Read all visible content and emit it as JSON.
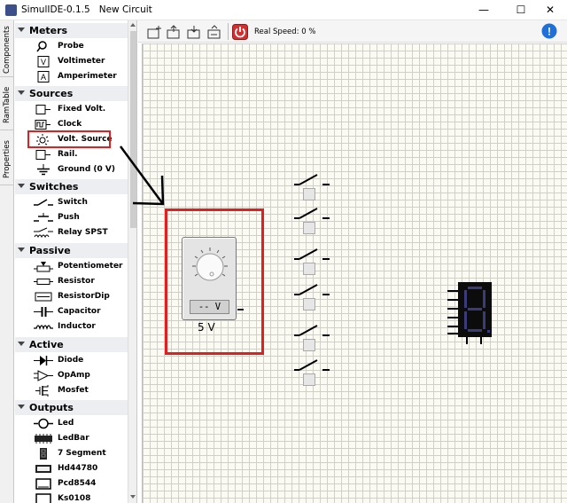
{
  "window": {
    "title": "SimulIDE-0.1.5   New Circuit",
    "controls": {
      "minimize": "—",
      "maximize": "☐",
      "close": "✕"
    }
  },
  "side_tabs": [
    "Components",
    "RamTable",
    "Properties"
  ],
  "categories": [
    {
      "label": "Meters",
      "items": [
        "Probe",
        "Voltimeter",
        "Amperimeter"
      ]
    },
    {
      "label": "Sources",
      "items": [
        "Fixed Volt.",
        "Clock",
        "Volt. Source",
        "Rail.",
        "Ground (0 V)"
      ]
    },
    {
      "label": "Switches",
      "items": [
        "Switch",
        "Push",
        "Relay SPST"
      ]
    },
    {
      "label": "Passive",
      "items": [
        "Potentiometer",
        "Resistor",
        "ResistorDip",
        "Capacitor",
        "Inductor"
      ]
    },
    {
      "label": "Active",
      "items": [
        "Diode",
        "OpAmp",
        "Mosfet"
      ]
    },
    {
      "label": "Outputs",
      "items": [
        "Led",
        "LedBar",
        "7 Segment",
        "Hd44780",
        "Pcd8544",
        "Ks0108"
      ]
    }
  ],
  "toolbar": {
    "buttons": [
      "new-circuit-icon",
      "open-circuit-icon",
      "save-circuit-icon",
      "save-as-icon",
      "power-icon"
    ],
    "speed_text": "Real Speed: 0 %",
    "info": "!"
  },
  "canvas": {
    "volt_source": {
      "display": "-- V",
      "label": "5 V"
    },
    "switch_count": 6,
    "seven_segment": {
      "digit": "8"
    }
  },
  "colors": {
    "highlight": "#e02020",
    "power": "#d32f2f",
    "info": "#1e6fd9",
    "seg_off": "#3b3b7a"
  }
}
